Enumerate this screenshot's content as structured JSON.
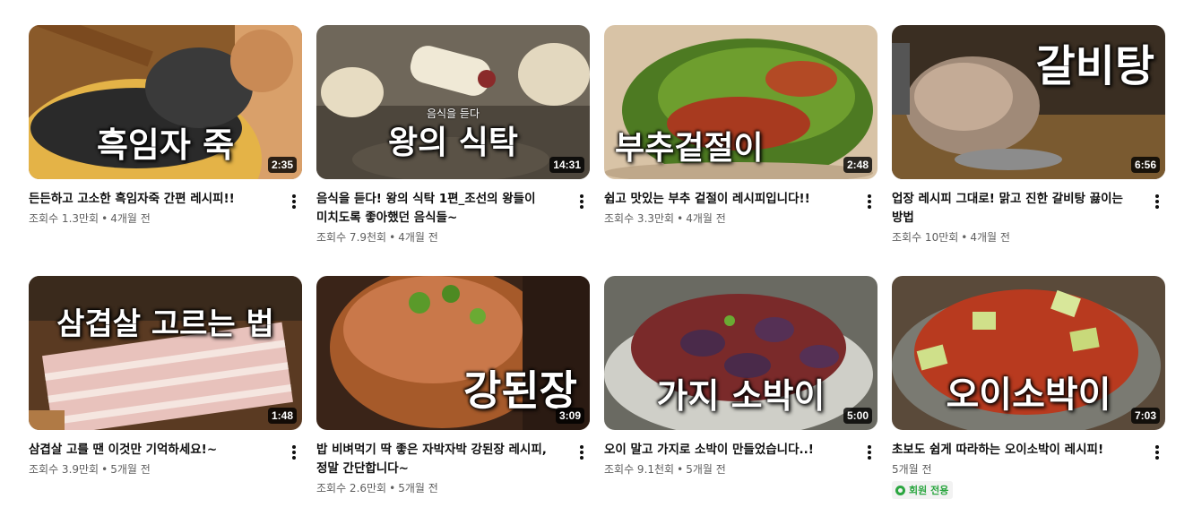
{
  "videos": [
    {
      "thumb_title": "흑임자 죽",
      "thumb_sub": "",
      "duration": "2:35",
      "title": "든든하고 고소한 흑임자죽 간편 레시피!!",
      "views": "조회수 1.3만회",
      "age": "4개월 전"
    },
    {
      "thumb_title": "왕의 식탁",
      "thumb_sub": "음식을 듣다",
      "duration": "14:31",
      "title": "음식을 듣다! 왕의 식탁 1편_조선의 왕들이 미치도록 좋아했던 음식들~",
      "views": "조회수 7.9천회",
      "age": "4개월 전"
    },
    {
      "thumb_title": "부추겉절이",
      "thumb_sub": "",
      "duration": "2:48",
      "title": "쉽고 맛있는 부추 겉절이 레시피입니다!!",
      "views": "조회수 3.3만회",
      "age": "4개월 전"
    },
    {
      "thumb_title": "갈비탕",
      "thumb_sub": "",
      "duration": "6:56",
      "title": "업장 레시피 그대로! 맑고 진한 갈비탕 끓이는 방법",
      "views": "조회수 10만회",
      "age": "4개월 전"
    },
    {
      "thumb_title": "삼겹살 고르는 법",
      "thumb_sub": "",
      "duration": "1:48",
      "title": "삼겹살 고를 땐 이것만 기억하세요!~",
      "views": "조회수 3.9만회",
      "age": "5개월 전"
    },
    {
      "thumb_title": "강된장",
      "thumb_sub": "",
      "duration": "3:09",
      "title": "밥 비벼먹기 딱 좋은 자박자박 강된장 레시피, 정말 간단합니다~",
      "views": "조회수 2.6만회",
      "age": "5개월 전"
    },
    {
      "thumb_title": "가지 소박이",
      "thumb_sub": "",
      "duration": "5:00",
      "title": "오이 말고 가지로 소박이 만들었습니다..!",
      "views": "조회수 9.1천회",
      "age": "5개월 전"
    },
    {
      "thumb_title": "오이소박이",
      "thumb_sub": "",
      "duration": "7:03",
      "title": "초보도 쉽게 따라하는 오이소박이 레시피!",
      "views": "",
      "age": "5개월 전",
      "badge": "회원 전용"
    }
  ],
  "colors": {
    "badge_green": "#2ba640",
    "meta_gray": "#606060"
  },
  "icons": {
    "more": "more-vert-icon",
    "badge": "members-only-icon"
  }
}
